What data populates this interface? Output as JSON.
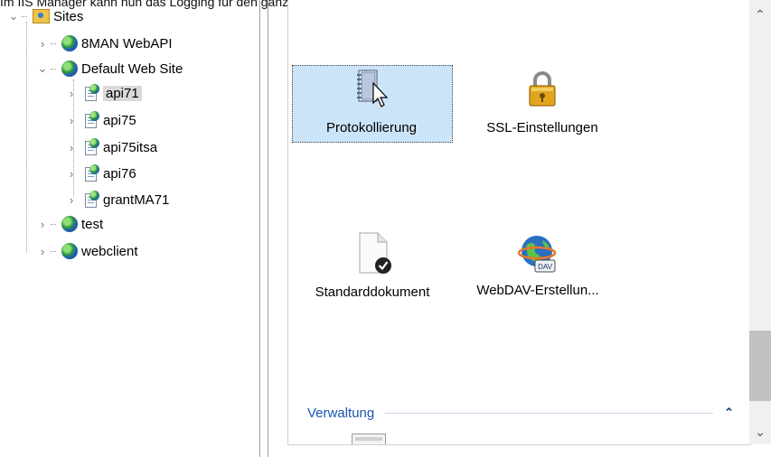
{
  "caption": "Im IIS Manager kann nun das Logging für den ganzen Server oder die einzelnen Sites konfiguriert werden:",
  "tree": {
    "root": {
      "label": "Sites"
    },
    "sites": [
      {
        "label": "8MAN WebAPI"
      },
      {
        "label": "Default Web Site"
      },
      {
        "label": "test"
      },
      {
        "label": "webclient"
      }
    ],
    "apps": [
      {
        "label": "api71",
        "selected": true
      },
      {
        "label": "api75"
      },
      {
        "label": "api75itsa"
      },
      {
        "label": "api76"
      },
      {
        "label": "grantMA71"
      }
    ]
  },
  "features": {
    "protokollierung": "Protokollierung",
    "ssl": "SSL-Einstellungen",
    "standarddokument": "Standarddokument",
    "webdav": "WebDAV-Erstellun..."
  },
  "group": {
    "title": "Verwaltung"
  },
  "icons": {
    "webdav_badge": "DAV"
  },
  "colors": {
    "selection": "#cce4f7",
    "group_title": "#1a56b0"
  }
}
